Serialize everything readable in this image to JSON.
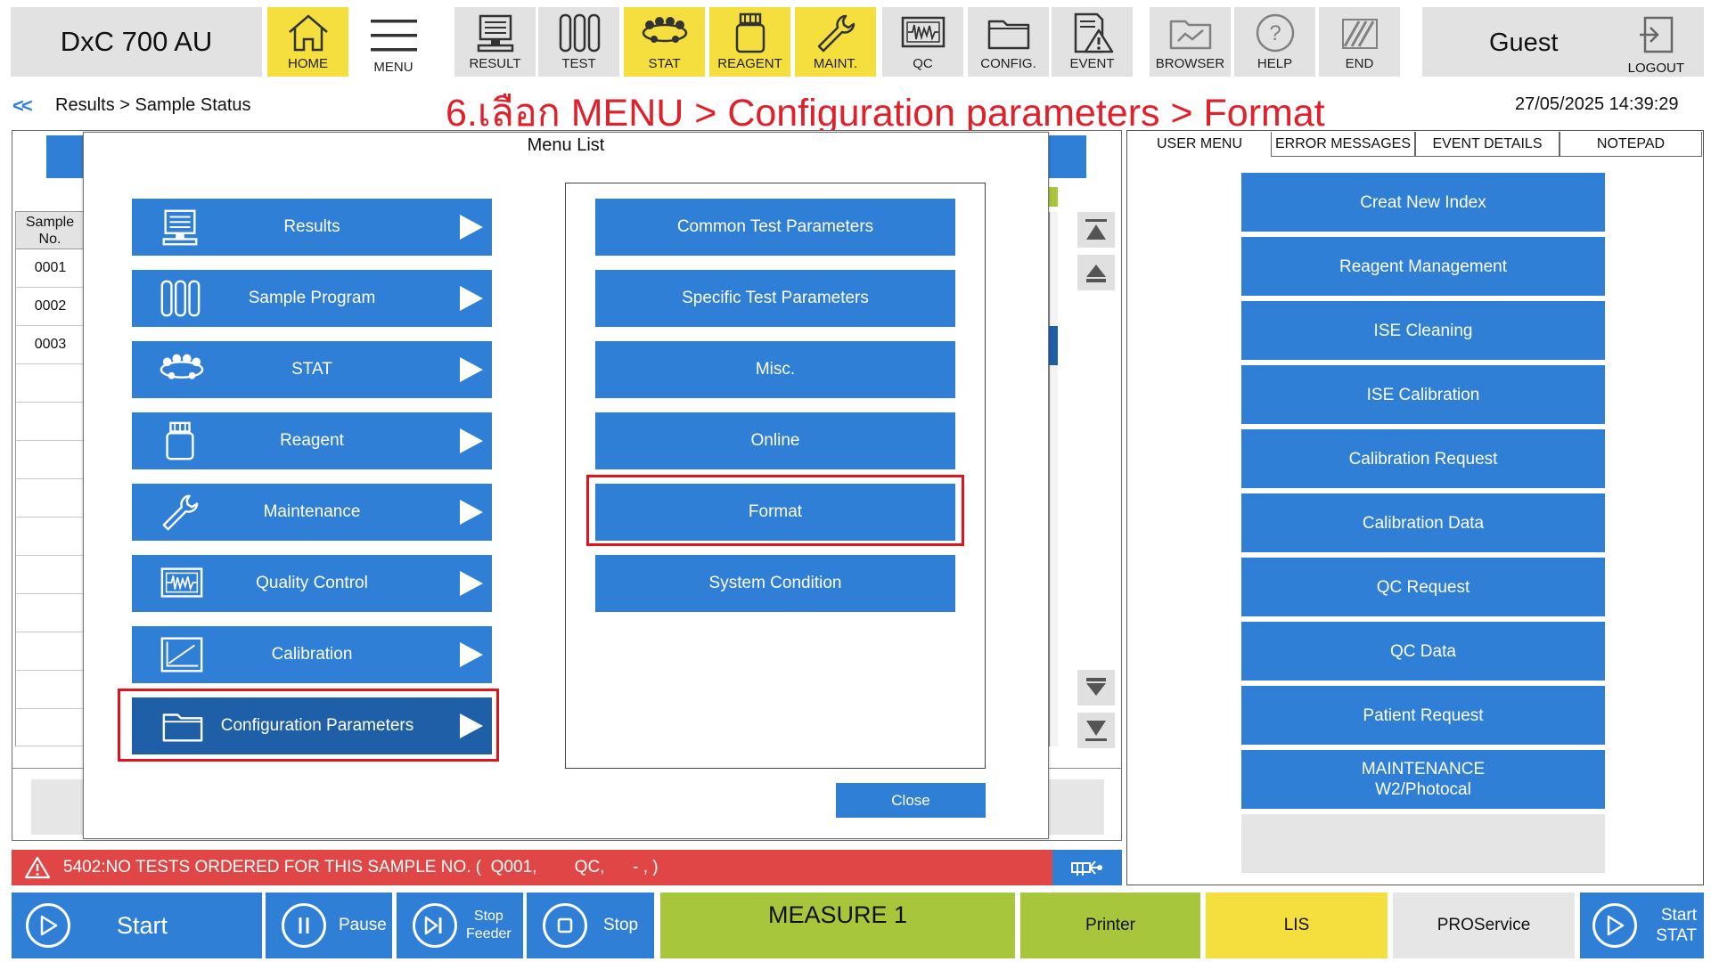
{
  "app": {
    "title": "DxC 700 AU"
  },
  "toolbar": [
    {
      "id": "home",
      "label": "HOME",
      "icon": "home-icon",
      "state": "active"
    },
    {
      "id": "menu",
      "label": "MENU",
      "icon": "hamburger-menu-icon",
      "state": "open"
    },
    {
      "id": "result",
      "label": "RESULT",
      "icon": "monitor-icon",
      "state": "normal"
    },
    {
      "id": "test",
      "label": "TEST",
      "icon": "test-tubes-icon",
      "state": "normal"
    },
    {
      "id": "stat",
      "label": "STAT",
      "icon": "stat-rack-icon",
      "state": "active"
    },
    {
      "id": "reagent",
      "label": "REAGENT",
      "icon": "reagent-bottle-icon",
      "state": "active"
    },
    {
      "id": "maint",
      "label": "MAINT.",
      "icon": "wrench-icon",
      "state": "active"
    },
    {
      "id": "qc",
      "label": "QC",
      "icon": "qc-waveform-icon",
      "state": "normal"
    },
    {
      "id": "config",
      "label": "CONFIG.",
      "icon": "folder-icon",
      "state": "normal"
    },
    {
      "id": "event",
      "label": "EVENT",
      "icon": "event-warning-icon",
      "state": "normal"
    },
    {
      "id": "browser",
      "label": "BROWSER",
      "icon": "browser-folder-icon",
      "state": "disabled"
    },
    {
      "id": "help",
      "label": "HELP",
      "icon": "help-icon",
      "state": "disabled"
    },
    {
      "id": "end",
      "label": "END",
      "icon": "end-stripes-icon",
      "state": "disabled"
    }
  ],
  "user": {
    "name": "Guest",
    "logout_label": "LOGOUT"
  },
  "header": {
    "back_label": "<<",
    "breadcrumb": "Results > Sample Status",
    "instruction": "6.เลือก MENU > Configuration parameters > Format",
    "datetime": "27/05/2025 14:39:29"
  },
  "sample_table": {
    "header": "Sample No.",
    "rows": [
      "0001",
      "0002",
      "0003"
    ]
  },
  "right_panel": {
    "tabs": [
      "USER MENU",
      "ERROR MESSAGES",
      "EVENT DETAILS",
      "NOTEPAD"
    ],
    "active_tab": "USER MENU",
    "buttons": [
      "Creat New Index",
      "Reagent Management",
      "ISE Cleaning",
      "ISE Calibration",
      "Calibration Request",
      "Calibration Data",
      "QC Request",
      "QC Data",
      "Patient Request",
      "MAINTENANCE\nW2/Photocal",
      ""
    ]
  },
  "error_bar": {
    "message": "5402:NO TESTS ORDERED FOR THIS SAMPLE NO. (  Q001,        QC,      - , )"
  },
  "bottom_bar": {
    "start": "Start",
    "pause": "Pause",
    "stop_feeder_1": "Stop",
    "stop_feeder_2": "Feeder",
    "stop": "Stop",
    "status": "MEASURE 1",
    "printer": "Printer",
    "lis": "LIS",
    "proservice": "PROService",
    "start_stat_1": "Start",
    "start_stat_2": "STAT"
  },
  "menu_list": {
    "title": "Menu List",
    "items": [
      {
        "label": "Results",
        "icon": "monitor-icon"
      },
      {
        "label": "Sample Program",
        "icon": "test-tubes-icon"
      },
      {
        "label": "STAT",
        "icon": "stat-rack-icon"
      },
      {
        "label": "Reagent",
        "icon": "reagent-bottle-icon"
      },
      {
        "label": "Maintenance",
        "icon": "wrench-icon"
      },
      {
        "label": "Quality Control",
        "icon": "qc-waveform-icon"
      },
      {
        "label": "Calibration",
        "icon": "calibration-chart-icon"
      },
      {
        "label": "Configuration Parameters",
        "icon": "folder-icon",
        "selected": true
      }
    ],
    "submenu": [
      "Common Test Parameters",
      "Specific Test Parameters",
      "Misc.",
      "Online",
      "Format",
      "System Condition"
    ],
    "highlighted_submenu": "Format",
    "close_label": "Close"
  },
  "colors": {
    "accent": "#2f7fd6",
    "accent_selected": "#1f5fa8",
    "yellow": "#f4df3e",
    "green": "#a8c63c",
    "error": "#e04646",
    "annotation": "#e0141c"
  }
}
